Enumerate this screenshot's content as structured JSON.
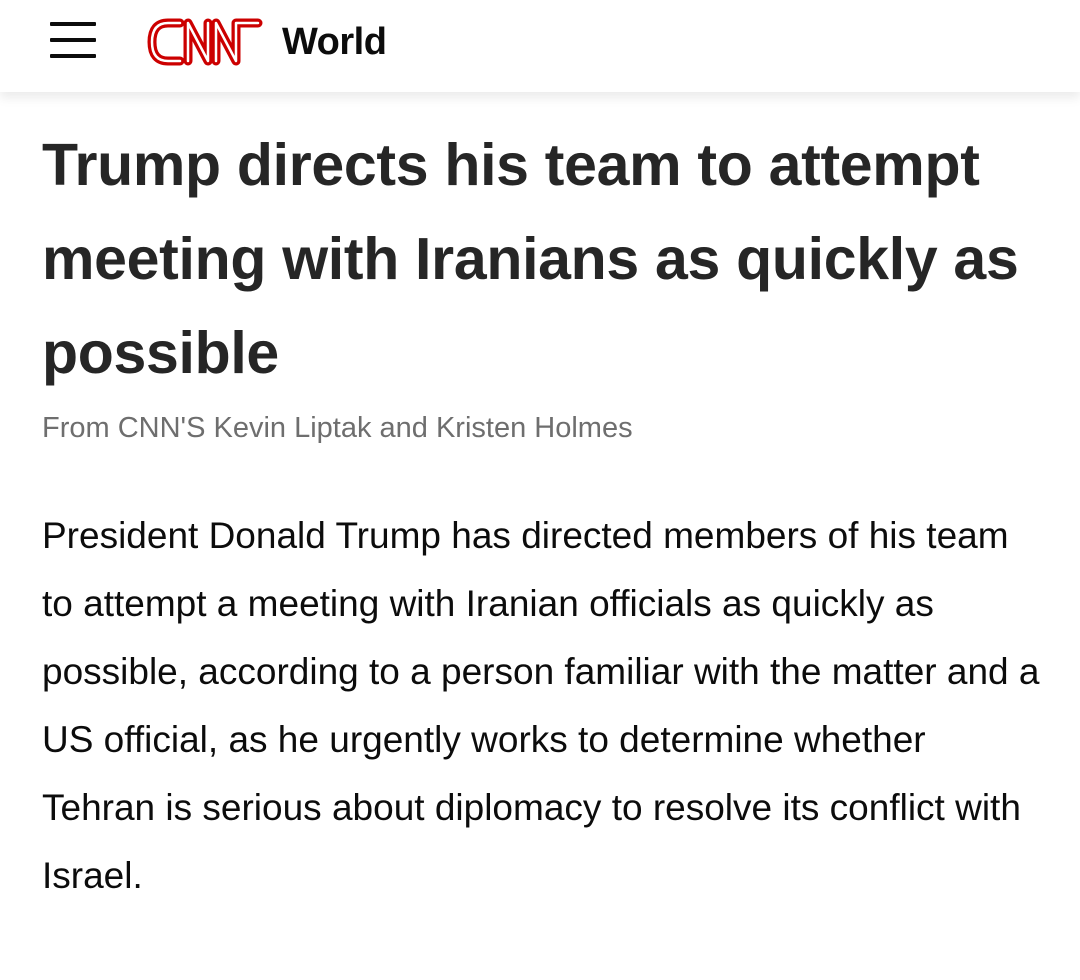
{
  "header": {
    "menu_icon": "hamburger-menu-icon",
    "logo_text": "CNN",
    "logo_color": "#cc0000",
    "section": "World"
  },
  "article": {
    "headline": "Trump directs his team to attempt meeting with Iranians as quickly as possible",
    "byline": "From CNN'S Kevin Liptak and Kristen Holmes",
    "body": "President Donald Trump has directed members of his team to attempt a meeting with Iranian officials as quickly as possible, according to a person familiar with the matter and a US official, as he urgently works to determine whether Tehran is serious about diplomacy to resolve its conflict with Israel."
  }
}
